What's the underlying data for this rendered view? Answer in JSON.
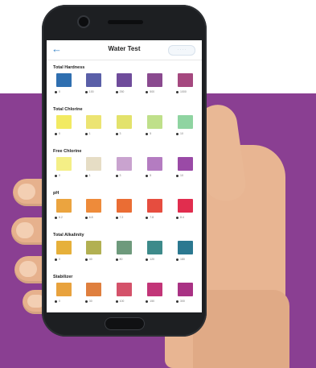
{
  "app": {
    "title": "Water Test",
    "header_button": "· · · ·"
  },
  "colors": {
    "background_band": "#8a3f92",
    "accent": "#3a86c8"
  },
  "sections": [
    {
      "title": "Total Hardness",
      "swatches": [
        {
          "color": "#2f6fb0",
          "value": "0"
        },
        {
          "color": "#5a5fa8",
          "value": "100"
        },
        {
          "color": "#6f4c9b",
          "value": "250"
        },
        {
          "color": "#8a4a8f",
          "value": "500"
        },
        {
          "color": "#a5487f",
          "value": "1000"
        }
      ]
    },
    {
      "title": "Total Chlorine",
      "swatches": [
        {
          "color": "#f2ea62",
          "value": "0"
        },
        {
          "color": "#ece472",
          "value": "1"
        },
        {
          "color": "#e3e26b",
          "value": "3"
        },
        {
          "color": "#bfe08a",
          "value": "5"
        },
        {
          "color": "#8fd4a1",
          "value": "10"
        }
      ]
    },
    {
      "title": "Free Chlorine",
      "swatches": [
        {
          "color": "#f4ef86",
          "value": "0"
        },
        {
          "color": "#e6ddc5",
          "value": "1"
        },
        {
          "color": "#c9a3cf",
          "value": "3"
        },
        {
          "color": "#b47cc1",
          "value": "5"
        },
        {
          "color": "#9a4aa6",
          "value": "10"
        }
      ]
    },
    {
      "title": "pH",
      "swatches": [
        {
          "color": "#eba43f",
          "value": "6.2"
        },
        {
          "color": "#ee8b3a",
          "value": "6.8"
        },
        {
          "color": "#ea6d34",
          "value": "7.2"
        },
        {
          "color": "#e64d3f",
          "value": "7.8"
        },
        {
          "color": "#e12d4e",
          "value": "8.4"
        }
      ]
    },
    {
      "title": "Total Alkalinity",
      "swatches": [
        {
          "color": "#e6b03a",
          "value": "0"
        },
        {
          "color": "#b2b052",
          "value": "40"
        },
        {
          "color": "#6e9a7c",
          "value": "80"
        },
        {
          "color": "#3d8a8a",
          "value": "120"
        },
        {
          "color": "#2b7890",
          "value": "180"
        }
      ]
    },
    {
      "title": "Stabilizer",
      "swatches": [
        {
          "color": "#e8a23d",
          "value": "0"
        },
        {
          "color": "#df7f3e",
          "value": "30"
        },
        {
          "color": "#d4526a",
          "value": "100"
        },
        {
          "color": "#c23578",
          "value": "150"
        },
        {
          "color": "#a93284",
          "value": "300"
        }
      ]
    }
  ]
}
